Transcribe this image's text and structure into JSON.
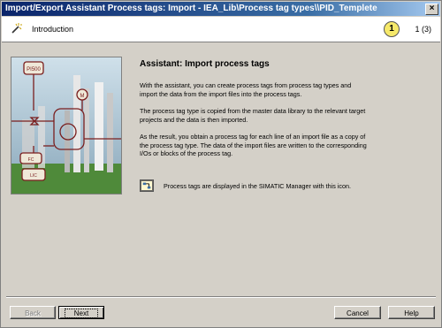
{
  "window": {
    "title": "Import/Export Assistant Process tags: Import - IEA_Lib\\Process tag types\\\\PID_Templete",
    "close_glyph": "×"
  },
  "header": {
    "step_label": "Introduction",
    "step_number": "1",
    "page_indicator": "1 (3)"
  },
  "content": {
    "heading": "Assistant: Import process tags",
    "paragraphs": [
      "With the assistant, you can create process tags from process tag types and import the data from the import files into the process tags.",
      "The process tag type is copied from the master data library to the relevant target projects and the data is then imported.",
      "As the result, you obtain a process tag for each line of an import file as a copy of the process tag type. The data of the import files are written to the corresponding I/Os or blocks of the process tag."
    ],
    "icon_note": "Process tags are displayed in the SIMATIC Manager with this icon."
  },
  "picture": {
    "labels": [
      "PI500",
      "TIC",
      "M",
      "FC",
      "LIC"
    ]
  },
  "buttons": {
    "back": "Back",
    "next": "Next",
    "cancel": "Cancel",
    "help": "Help"
  },
  "icons": {
    "wizard": "wand-icon",
    "process_tag": "process-tag-icon",
    "close": "close-icon"
  }
}
